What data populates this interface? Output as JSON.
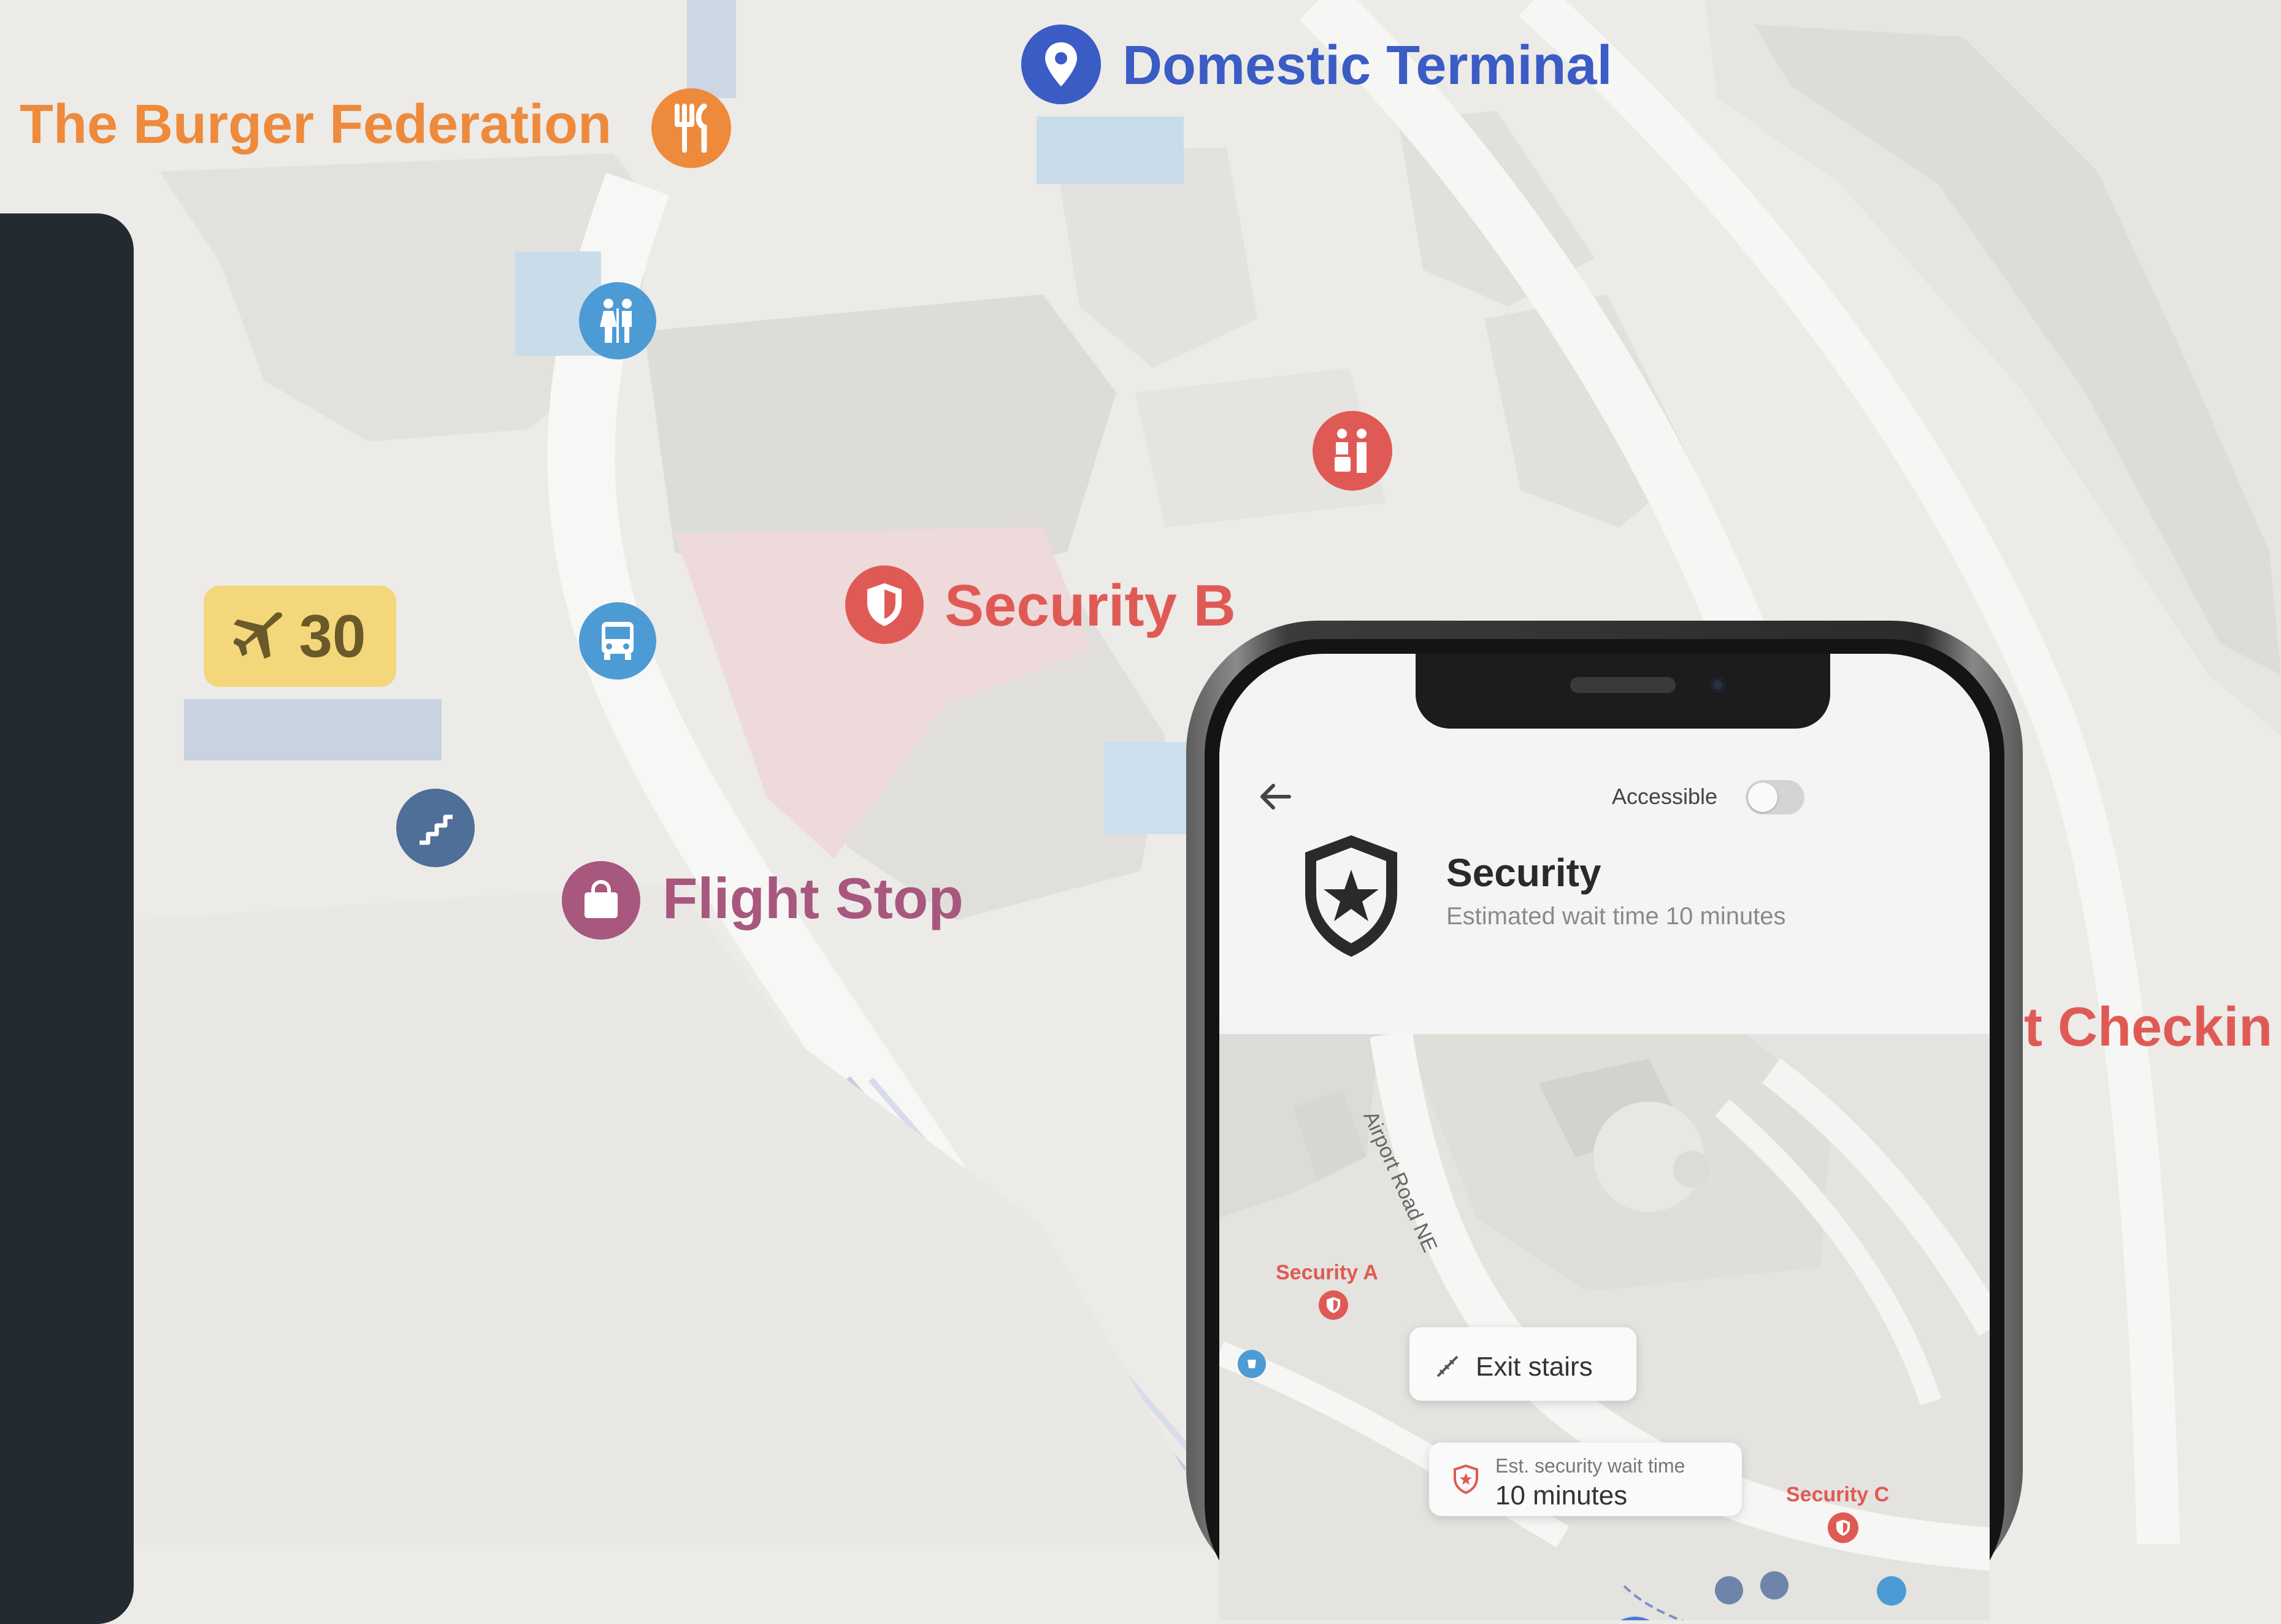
{
  "map": {
    "labels": {
      "burger": "The Burger Federation",
      "domestic": "Domestic Terminal",
      "security_b": "Security B",
      "flight_stop": "Flight Stop",
      "checkin": "t Checkin"
    },
    "gate": {
      "number": "30",
      "icon": "airplane-icon"
    },
    "colors": {
      "orange": "#ee8a3c",
      "blue": "#3a5cc4",
      "red": "#e05a55",
      "pink": "#a8577e",
      "gate_yellow": "#f3d77a"
    },
    "pins": [
      "restaurant-icon",
      "location-pin-icon",
      "restroom-icon",
      "security-shield-icon",
      "baggage-icon",
      "bus-icon",
      "stairs-icon",
      "shopping-bag-icon"
    ]
  },
  "phone": {
    "accessible_label": "Accessible",
    "accessible_on": false,
    "title": "Security",
    "subtitle": "Estimated wait time 10 minutes",
    "mini_map": {
      "road": "Airport Road NE",
      "security_a": "Security A",
      "security_c": "Security C",
      "exit_stairs": "Exit stairs",
      "wait_label": "Est. security wait time",
      "wait_value": "10 minutes"
    }
  }
}
